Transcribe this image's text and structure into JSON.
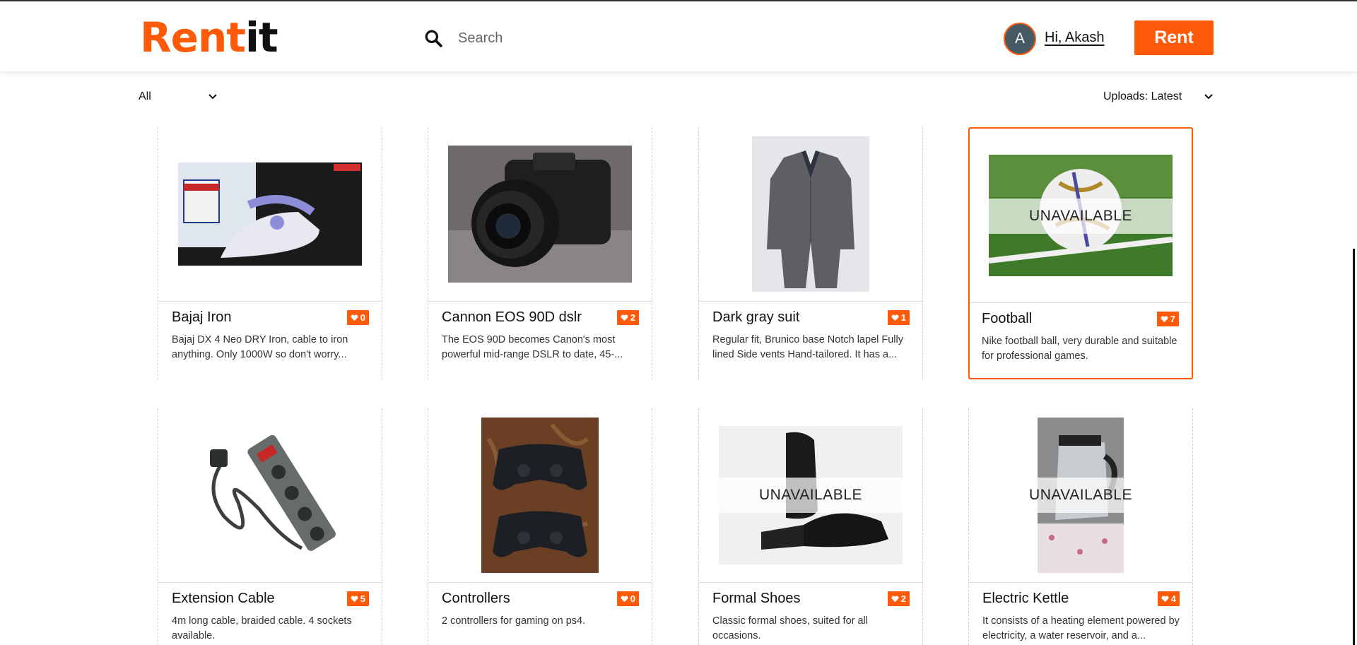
{
  "app": {
    "logo_part1": "Rent",
    "logo_part2": "it",
    "brand_color": "#ff5a0a"
  },
  "header": {
    "search_placeholder": "Search",
    "avatar_initial": "A",
    "greeting": "Hi, Akash",
    "rent_button": "Rent"
  },
  "filters": {
    "category": "All",
    "sort": "Uploads: Latest"
  },
  "products": [
    {
      "title": "Bajaj Iron",
      "likes": "0",
      "desc": "Bajaj DX 4 Neo DRY Iron, cable to iron anything. Only 1000W so don't worry...",
      "unavailable": false,
      "image": "iron-image"
    },
    {
      "title": "Cannon EOS 90D dslr",
      "likes": "2",
      "desc": "The EOS 90D becomes Canon's most powerful mid-range DSLR to date, 45-...",
      "unavailable": false,
      "image": "camera-image"
    },
    {
      "title": "Dark gray suit",
      "likes": "1",
      "desc": "Regular fit, Brunico base Notch lapel Fully lined Side vents Hand-tailored. It has a...",
      "unavailable": false,
      "image": "suit-image"
    },
    {
      "title": "Football",
      "likes": "7",
      "desc": "Nike football ball, very durable and suitable for professional games.",
      "unavailable": true,
      "image": "football-image"
    },
    {
      "title": "Extension Cable",
      "likes": "5",
      "desc": "4m long cable, braided cable. 4 sockets available.",
      "unavailable": false,
      "image": "extension-cable-image"
    },
    {
      "title": "Controllers",
      "likes": "0",
      "desc": "2 controllers for gaming on ps4.",
      "unavailable": false,
      "image": "controllers-image"
    },
    {
      "title": "Formal Shoes",
      "likes": "2",
      "desc": "Classic formal shoes, suited for all occasions.",
      "unavailable": true,
      "image": "shoes-image"
    },
    {
      "title": "Electric Kettle",
      "likes": "4",
      "desc": "It consists of a heating element powered by electricity, a water reservoir, and a...",
      "unavailable": true,
      "image": "kettle-image"
    }
  ],
  "unavailable_label": "UNAVAILABLE"
}
